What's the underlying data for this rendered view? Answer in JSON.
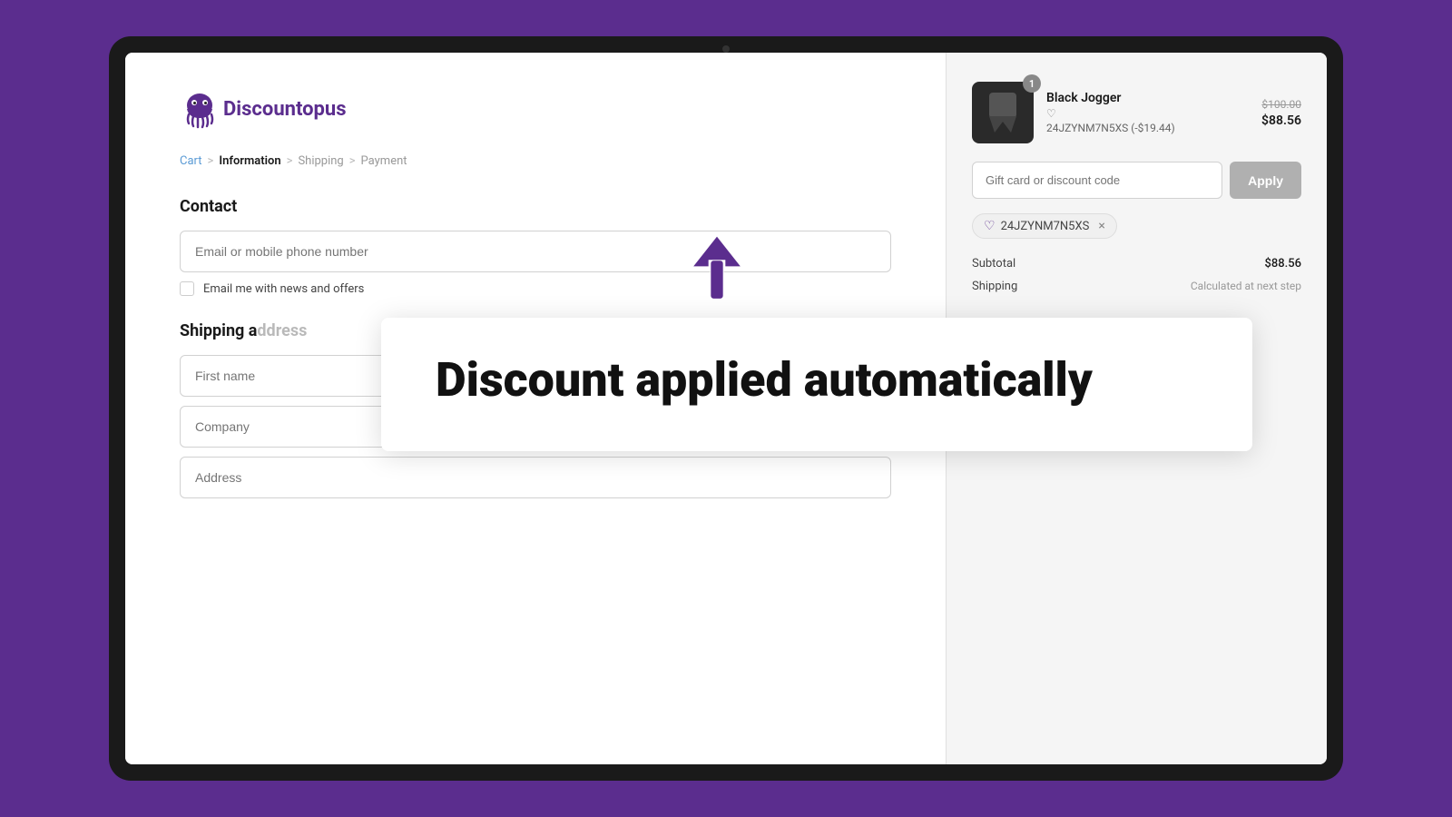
{
  "logo": {
    "text_before": "Disco",
    "text_accent": "u",
    "text_after": "ntopus"
  },
  "breadcrumb": {
    "cart": "Cart",
    "information": "Information",
    "shipping": "Shipping",
    "payment": "Payment",
    "sep": ">"
  },
  "contact": {
    "heading": "Contact",
    "email_placeholder": "Email or mobile phone number",
    "checkbox_label": "Email me with news and offers"
  },
  "shipping": {
    "heading": "Shipping address",
    "first_name_placeholder": "First name",
    "company_placeholder": "Company",
    "address_placeholder": "Address"
  },
  "order_summary": {
    "product_name": "Black Jogger",
    "product_badge": "1",
    "product_code": "24JZYNM7N5XS (-$19.44)",
    "price_original": "$100.00",
    "price_discounted": "$88.56",
    "discount_placeholder": "Gift card or discount code",
    "apply_label": "Apply",
    "discount_tag_code": "24JZYNM7N5XS",
    "subtotal_label": "Subtotal",
    "subtotal_value": "$88.56",
    "shipping_label": "Shipping",
    "shipping_value": "Calculated at next step"
  },
  "overlay": {
    "text": "Discount applied automatically"
  }
}
